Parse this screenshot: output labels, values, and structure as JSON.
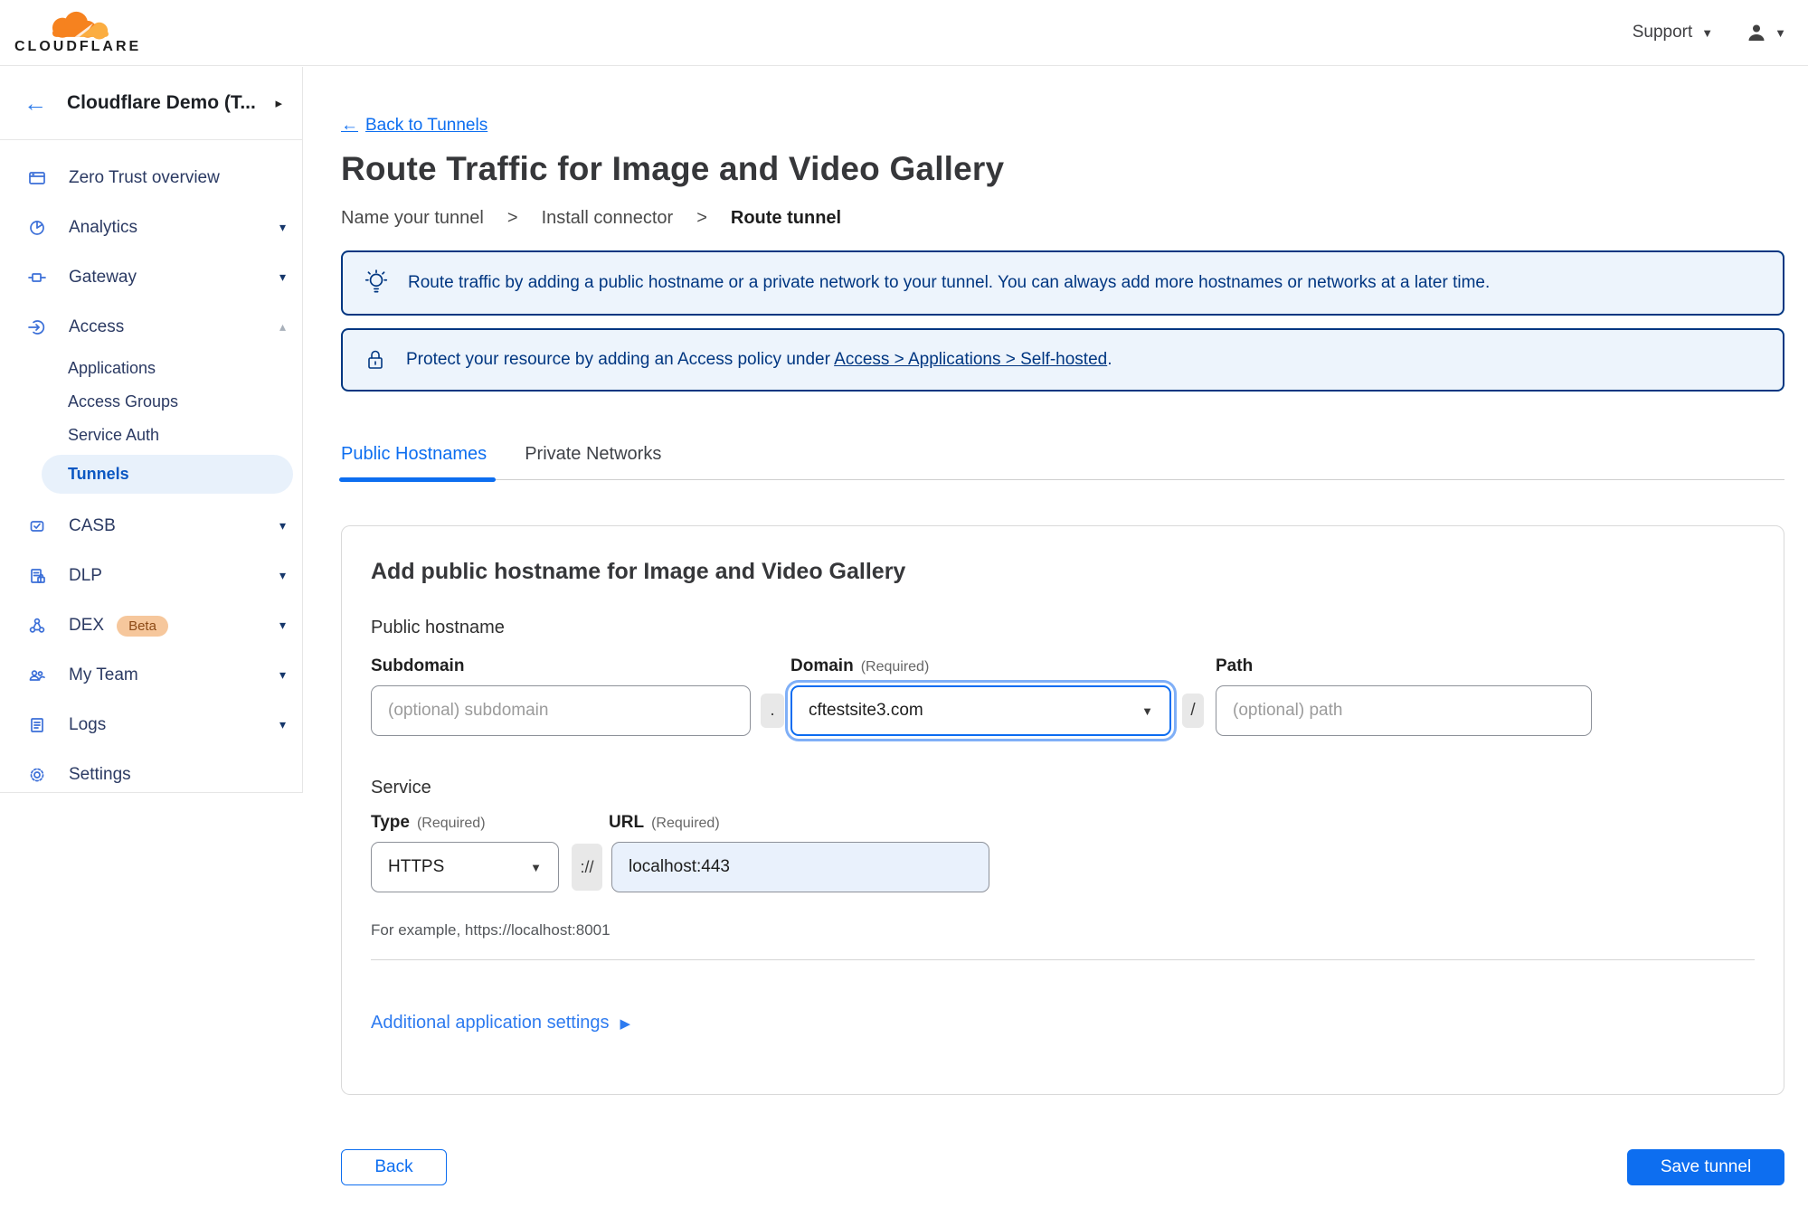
{
  "header": {
    "brand": "CLOUDFLARE",
    "support_label": "Support"
  },
  "icons": {
    "back_arrow": "←",
    "chevron_right": "▸",
    "chevron_down": "▾",
    "chevron_up": "▴",
    "caret_down": "▼",
    "arrow_right_filled": "▶"
  },
  "colors": {
    "accent_blue": "#0d6ef0",
    "banner_navy": "#003681",
    "banner_bg": "#edf4fc",
    "sidebar_icon_blue": "#3b6fd8",
    "active_pill_bg": "#e8f1fb",
    "active_pill_text": "#0a57c2",
    "beta_badge_bg": "#f6c79c",
    "beta_badge_text": "#8d4b17",
    "logo_orange": "#f6821f",
    "logo_orange_light": "#fbad41"
  },
  "sidebar": {
    "account_label": "Cloudflare Demo (T...",
    "items": [
      {
        "label": "Zero Trust overview"
      },
      {
        "label": "Analytics"
      },
      {
        "label": "Gateway"
      },
      {
        "label": "Access"
      },
      {
        "label": "CASB"
      },
      {
        "label": "DLP"
      },
      {
        "label": "DEX",
        "badge": "Beta"
      },
      {
        "label": "My Team"
      },
      {
        "label": "Logs"
      },
      {
        "label": "Settings"
      }
    ],
    "access_children": [
      {
        "label": "Applications"
      },
      {
        "label": "Access Groups"
      },
      {
        "label": "Service Auth"
      },
      {
        "label": "Tunnels",
        "active": true
      }
    ]
  },
  "main": {
    "back_link": "Back to Tunnels",
    "title": "Route Traffic for Image and Video Gallery",
    "steps": [
      "Name your tunnel",
      "Install connector",
      "Route tunnel"
    ],
    "steps_separator": ">",
    "banners": [
      {
        "icon": "lightbulb-icon",
        "text": "Route traffic by adding a public hostname or a private network to your tunnel. You can always add more hostnames or networks at a later time."
      },
      {
        "icon": "lock-icon",
        "text_prefix": "Protect your resource by adding an Access policy under ",
        "link_text": "Access > Applications > Self-hosted",
        "text_suffix": "."
      }
    ],
    "tabs": [
      {
        "label": "Public Hostnames",
        "active": true
      },
      {
        "label": "Private Networks",
        "active": false
      }
    ],
    "card": {
      "heading": "Add public hostname for Image and Video Gallery",
      "hostname_section_label": "Public hostname",
      "subdomain_label": "Subdomain",
      "domain_label": "Domain",
      "required_tag": "(Required)",
      "path_label": "Path",
      "subdomain_placeholder": "(optional) subdomain",
      "dot_separator": ".",
      "domain_value": "cftestsite3.com",
      "slash_separator": "/",
      "path_placeholder": "(optional) path",
      "service_section_label": "Service",
      "type_label": "Type",
      "url_label": "URL",
      "type_value": "HTTPS",
      "scheme_separator": "://",
      "url_value": "localhost:443",
      "example_text": "For example, https://localhost:8001",
      "additional_settings_label": "Additional application settings"
    },
    "back_button": "Back",
    "save_button": "Save tunnel"
  }
}
